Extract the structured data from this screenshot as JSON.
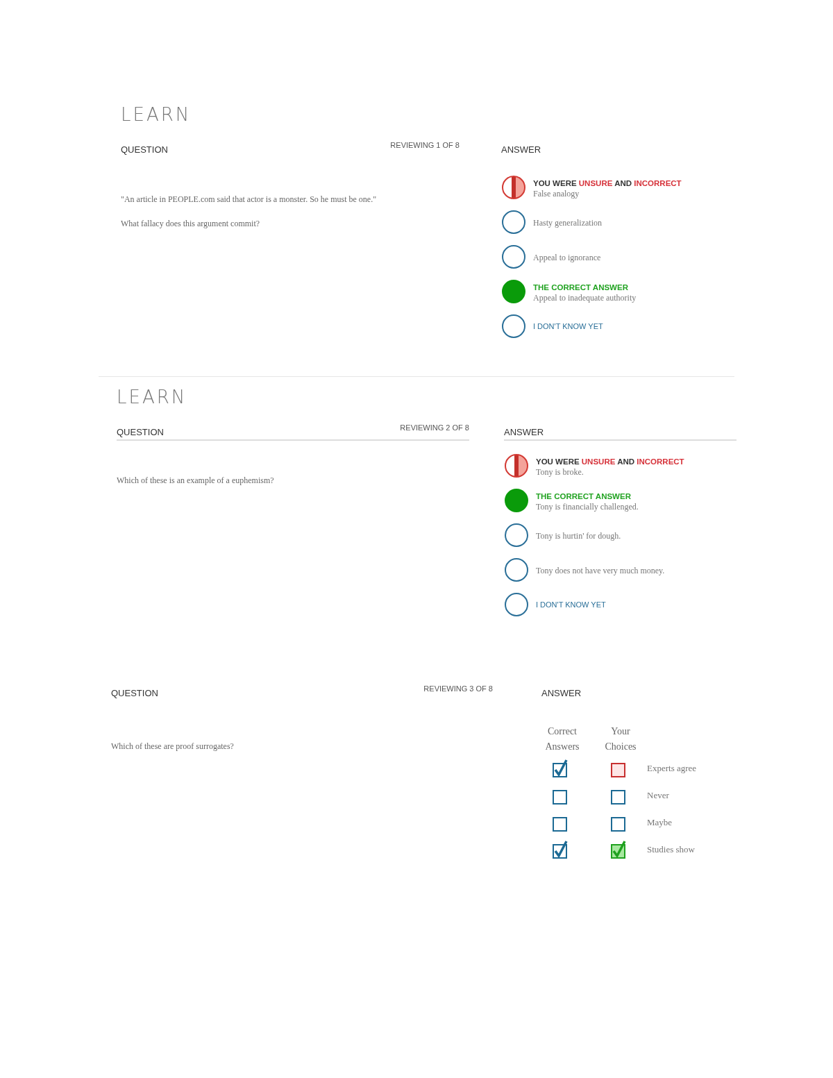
{
  "sections": [
    {
      "logo": "LEARN",
      "question_label": "QUESTION",
      "progress": "REVIEWING 1 OF 8",
      "answer_label": "ANSWER",
      "underlined": false,
      "kind": "radio",
      "question": [
        "\"An article in PEOPLE.com said that actor is a monster. So he must be one.\"",
        "What fallacy does this argument commit?"
      ],
      "options": [
        {
          "kind": "unsure_incorrect",
          "status": [
            {
              "text": "YOU WERE ",
              "highlight": false
            },
            {
              "text": "UNSURE",
              "highlight": true
            },
            {
              "text": " AND ",
              "highlight": false
            },
            {
              "text": "INCORRECT",
              "highlight": true
            }
          ],
          "text": "False analogy"
        },
        {
          "kind": "plain",
          "text": "Hasty generalization"
        },
        {
          "kind": "plain",
          "text": "Appeal to ignorance"
        },
        {
          "kind": "correct",
          "status": [
            {
              "text": "THE CORRECT ANSWER",
              "highlight": false
            }
          ],
          "text": "Appeal to inadequate authority"
        },
        {
          "kind": "dont_know",
          "text": "I DON'T KNOW YET"
        }
      ]
    },
    {
      "logo": "LEARN",
      "question_label": "QUESTION",
      "progress": "REVIEWING 2 OF 8",
      "answer_label": "ANSWER",
      "underlined": true,
      "kind": "radio",
      "question": [
        "Which of these is an example of a euphemism?"
      ],
      "options": [
        {
          "kind": "unsure_incorrect",
          "status": [
            {
              "text": "YOU WERE ",
              "highlight": false
            },
            {
              "text": "UNSURE",
              "highlight": true
            },
            {
              "text": " AND ",
              "highlight": false
            },
            {
              "text": "INCORRECT",
              "highlight": true
            }
          ],
          "text": "Tony is broke."
        },
        {
          "kind": "correct",
          "status": [
            {
              "text": "THE CORRECT ANSWER",
              "highlight": false
            }
          ],
          "text": "Tony is financially challenged."
        },
        {
          "kind": "plain",
          "text": "Tony is hurtin' for dough."
        },
        {
          "kind": "plain",
          "text": "Tony does not have very much money."
        },
        {
          "kind": "dont_know",
          "text": "I DON'T KNOW YET"
        }
      ]
    },
    {
      "question_label": "QUESTION",
      "progress": "REVIEWING 3 OF 8",
      "answer_label": "ANSWER",
      "underlined": false,
      "kind": "checkbox",
      "question": [
        "Which of these are proof surrogates?"
      ],
      "columns": [
        "Correct Answers",
        "Your Choices"
      ],
      "rows": [
        {
          "text": "Experts agree",
          "correct": true,
          "kind": "wrong_choice"
        },
        {
          "text": "Never",
          "correct": false,
          "kind": "unchosen"
        },
        {
          "text": "Maybe",
          "correct": false,
          "kind": "unchosen"
        },
        {
          "text": "Studies show",
          "correct": true,
          "kind": "right_choice"
        }
      ]
    }
  ]
}
